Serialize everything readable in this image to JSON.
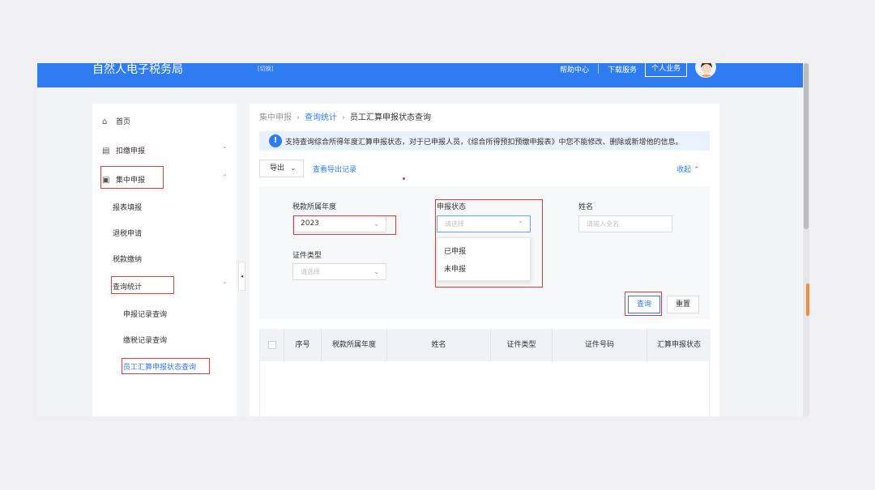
{
  "app": {
    "title": "自然人电子税务局",
    "switch": "[切换]",
    "help": "帮助中心",
    "download": "下载服务",
    "personal": "个人业务"
  },
  "sidebar": {
    "home": "首页",
    "withhold": "扣缴申报",
    "collective": "集中申报",
    "items": [
      "报表填报",
      "退税申请",
      "税款缴纳"
    ],
    "query_stats": "查询统计",
    "sub_items": [
      "申报记录查询",
      "缴税记录查询",
      "员工汇算申报状态查询"
    ]
  },
  "breadcrumb": [
    "集中申报",
    "查询统计",
    "员工汇算申报状态查询"
  ],
  "notice": "支持查询综合所得年度汇算申报状态，对于已申报人员，《综合所得预扣预缴申报表》中您不能修改、删除或新增他的信息。",
  "toolbar": {
    "export": "导出",
    "export_log": "查看导出记录",
    "collapse": "收起"
  },
  "form": {
    "year_label": "税款所属年度",
    "year_value": "2023",
    "status_label": "申报状态",
    "status_placeholder": "请选择",
    "status_options": [
      "已申报",
      "未申报"
    ],
    "name_label": "姓名",
    "name_placeholder": "请输入全名",
    "id_type_label": "证件类型",
    "id_type_placeholder": "请选择",
    "query": "查询",
    "reset": "重置"
  },
  "table": {
    "columns": [
      "序号",
      "税款所属年度",
      "姓名",
      "证件类型",
      "证件号码",
      "汇算申报状态"
    ]
  },
  "colors": {
    "brand_blue": "#2f7cf0",
    "highlight_red": "#e53935"
  }
}
